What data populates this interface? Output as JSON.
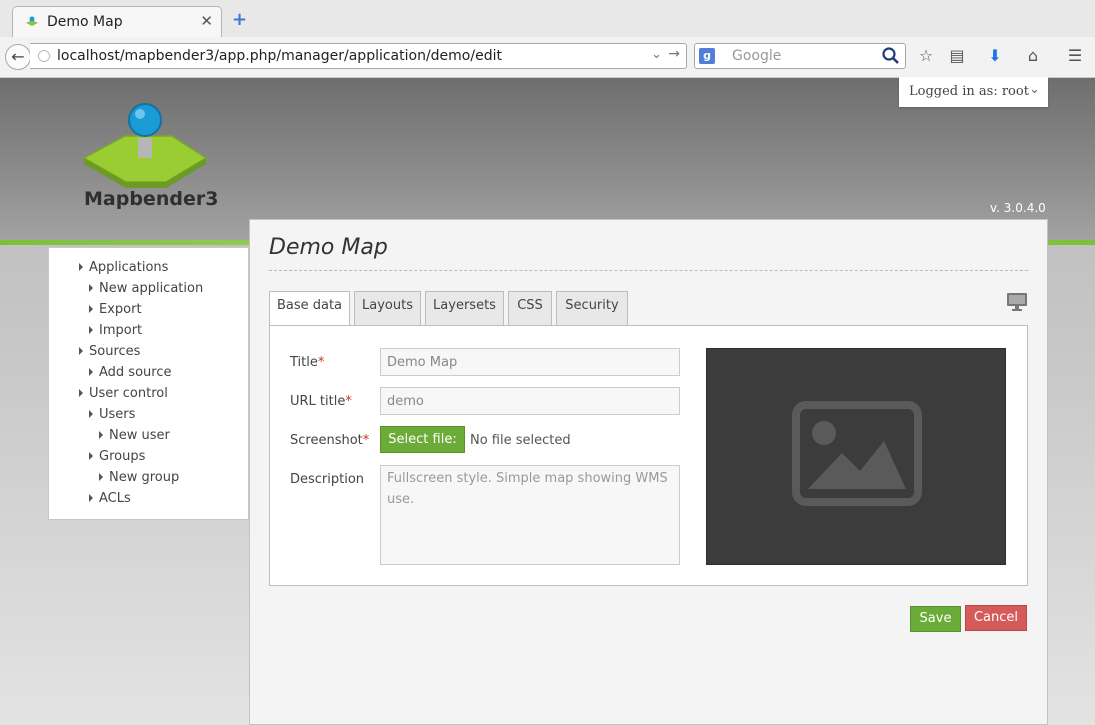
{
  "browser": {
    "tab_title": "Demo Map",
    "url": "localhost/mapbender3/app.php/manager/application/demo/edit",
    "search_placeholder": "Google"
  },
  "header": {
    "brand": "Mapbender3",
    "version": "v. 3.0.4.0",
    "login_label": "Logged in as: root"
  },
  "sidebar": {
    "items": [
      {
        "label": "Applications",
        "level": 0
      },
      {
        "label": "New application",
        "level": 1
      },
      {
        "label": "Export",
        "level": 1
      },
      {
        "label": "Import",
        "level": 1
      },
      {
        "label": "Sources",
        "level": 0
      },
      {
        "label": "Add source",
        "level": 1
      },
      {
        "label": "User control",
        "level": 0
      },
      {
        "label": "Users",
        "level": 1
      },
      {
        "label": "New user",
        "level": 2
      },
      {
        "label": "Groups",
        "level": 1
      },
      {
        "label": "New group",
        "level": 2
      },
      {
        "label": "ACLs",
        "level": 1
      }
    ]
  },
  "main": {
    "title": "Demo Map",
    "tabs": [
      "Base data",
      "Layouts",
      "Layersets",
      "CSS",
      "Security"
    ],
    "active_tab": "Base data",
    "form": {
      "title_label": "Title",
      "title_value": "Demo Map",
      "url_label": "URL title",
      "url_value": "demo",
      "screenshot_label": "Screenshot",
      "select_file_label": "Select file:",
      "no_file_label": "No file selected",
      "description_label": "Description",
      "description_value": "Fullscreen style. Simple map showing WMS use."
    },
    "save_label": "Save",
    "cancel_label": "Cancel"
  },
  "colors": {
    "accent_green": "#6bab38",
    "cancel_red": "#d55b5b",
    "required_red": "#c0392b"
  }
}
